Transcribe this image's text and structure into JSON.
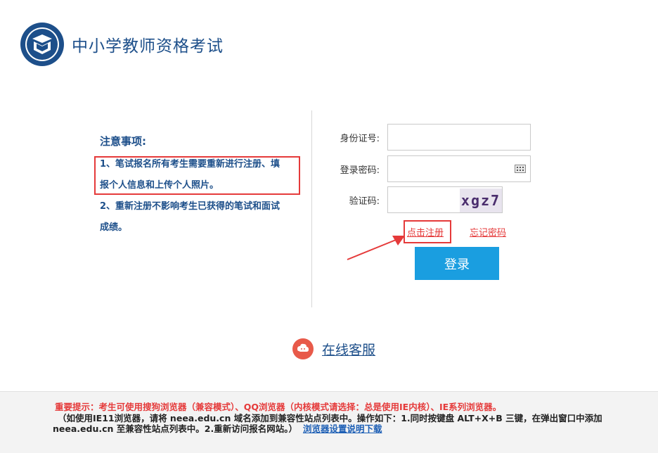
{
  "header": {
    "title": "中小学教师资格考试"
  },
  "notice": {
    "title": "注意事项:",
    "item1_line1": "1、笔试报名所有考生需要重新进行注册、填",
    "item1_line2": "报个人信息和上传个人照片。",
    "item2_line1": "2、重新注册不影响考生已获得的笔试和面试",
    "item2_line2": "成绩。"
  },
  "form": {
    "id_label": "身份证号:",
    "id_value": "",
    "password_label": "登录密码:",
    "password_value": "",
    "captcha_label": "验证码:",
    "captcha_value": "",
    "captcha_text": "xgz7",
    "register_link": "点击注册",
    "forgot_link": "忘记密码",
    "login_button": "登录"
  },
  "service": {
    "label": "在线客服",
    "icon": "customer-service-icon"
  },
  "footer": {
    "line1": "重要提示：考生可使用搜狗浏览器（兼容模式）、QQ浏览器（内核模式请选择：总是使用IE内核）、IE系列浏览器。",
    "line2": "（如使用IE11浏览器，请将 neea.edu.cn 域名添加到兼容性站点列表中。操作如下：1.同时按键盘 ALT+X+B 三键，在弹出窗口中添加",
    "line3": "neea.edu.cn 至兼容性站点列表中。2.重新访问报名网站。）",
    "download_link": "浏览器设置说明下载"
  },
  "colors": {
    "brand_blue": "#1d4f8a",
    "button_blue": "#1a9ee0",
    "alert_red": "#e53a3a"
  }
}
